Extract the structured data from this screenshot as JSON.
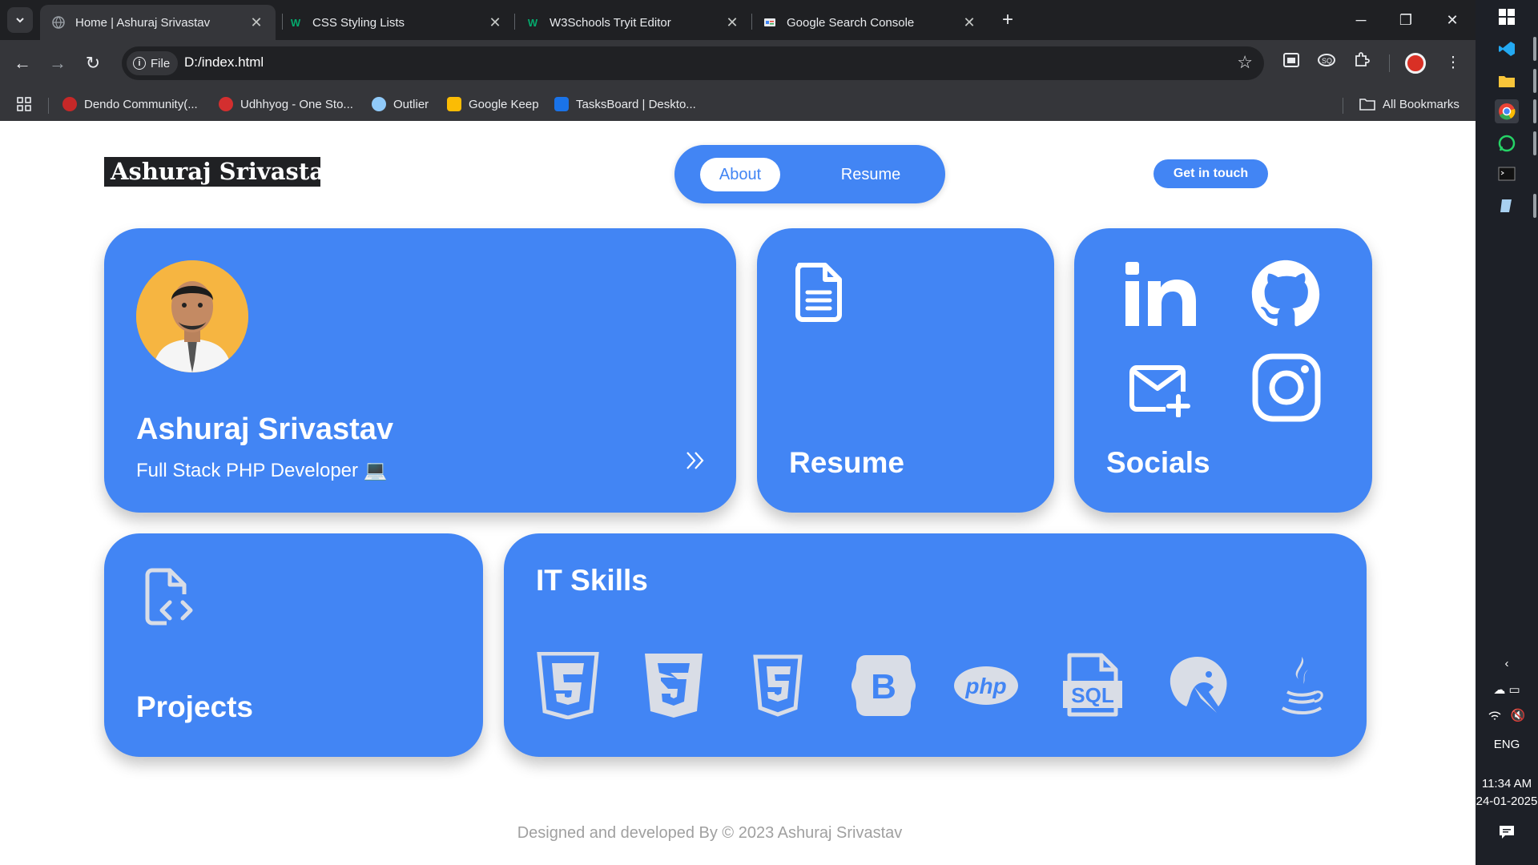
{
  "browser": {
    "tabs": [
      {
        "title": "Home | Ashuraj Srivastav",
        "active": true,
        "icon": "globe-icon"
      },
      {
        "title": "CSS Styling Lists",
        "active": false,
        "icon": "w3schools-icon"
      },
      {
        "title": "W3Schools Tryit Editor",
        "active": false,
        "icon": "w3schools-icon"
      },
      {
        "title": "Google Search Console",
        "active": false,
        "icon": "search-console-icon"
      }
    ],
    "address": {
      "scheme_label": "File",
      "url": "D:/index.html"
    },
    "bookmarks": [
      {
        "label": "Dendo Community(...",
        "color": "#c62828"
      },
      {
        "label": "Udhhyog - One Sto...",
        "color": "#d32f2f"
      },
      {
        "label": "Outlier",
        "color": "#90caf9"
      },
      {
        "label": "Google Keep",
        "color": "#fbbc04"
      },
      {
        "label": "TasksBoard | Deskto...",
        "color": "#1a73e8"
      }
    ],
    "all_bookmarks_label": "All Bookmarks"
  },
  "taskbar": {
    "language": "ENG",
    "time": "11:34 AM",
    "date": "24-01-2025"
  },
  "site": {
    "brand": "Ashuraj Srivastav",
    "nav": {
      "about": "About",
      "resume": "Resume"
    },
    "cta": "Get in touch",
    "profile": {
      "name": "Ashuraj Srivastav",
      "role": "Full Stack PHP Developer 💻"
    },
    "resume_card": {
      "title": "Resume"
    },
    "socials_card": {
      "title": "Socials",
      "links": [
        "linkedin-icon",
        "github-icon",
        "mail-plus-icon",
        "instagram-icon"
      ]
    },
    "projects_card": {
      "title": "Projects"
    },
    "skills_card": {
      "title": "IT Skills",
      "skills": [
        "html5-icon",
        "css3-icon",
        "html5-outline-icon",
        "bootstrap-icon",
        "php-icon",
        "sql-icon",
        "mariadb-icon",
        "java-icon"
      ]
    },
    "footer": "Designed and developed By © 2023 Ashuraj Srivastav"
  },
  "colors": {
    "accent": "#4285f4",
    "chrome_dark": "#202124",
    "chrome_mid": "#35363a",
    "skill_icon": "#d9dde6"
  }
}
